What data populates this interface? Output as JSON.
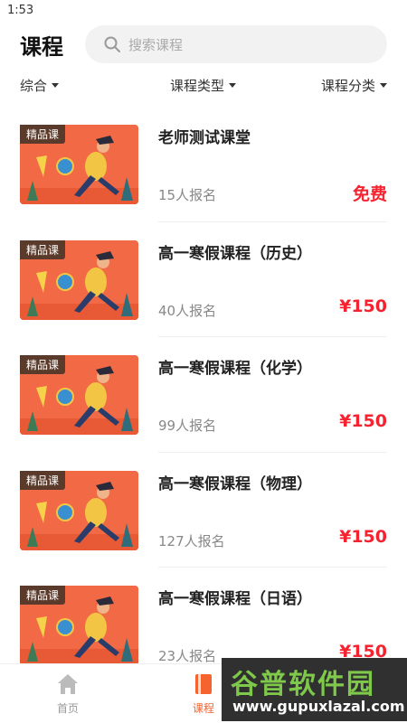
{
  "status_bar": {
    "time": "1:53"
  },
  "header": {
    "title": "课程",
    "search_placeholder": "搜索课程"
  },
  "filters": {
    "all": "综合",
    "type": "课程类型",
    "category": "课程分类"
  },
  "courses": [
    {
      "badge": "精品课",
      "title": "老师测试课堂",
      "enrolled": "15人报名",
      "price": "免费"
    },
    {
      "badge": "精品课",
      "title": "高一寒假课程（历史）",
      "enrolled": "40人报名",
      "price": "¥150"
    },
    {
      "badge": "精品课",
      "title": "高一寒假课程（化学）",
      "enrolled": "99人报名",
      "price": "¥150"
    },
    {
      "badge": "精品课",
      "title": "高一寒假课程（物理）",
      "enrolled": "127人报名",
      "price": "¥150"
    },
    {
      "badge": "精品课",
      "title": "高一寒假课程（日语）",
      "enrolled": "23人报名",
      "price": "¥150"
    }
  ],
  "tabs": {
    "home": "首页",
    "course": "课程"
  },
  "watermark": {
    "main": "谷普软件园",
    "url": "www.gupuxlazal.com"
  },
  "colors": {
    "accent": "#f5632f",
    "price": "#f5232f",
    "badge_bg": "#5a3a2a",
    "watermark_green": "#7ec84a"
  },
  "icons": {
    "search": "search-icon",
    "caret": "caret-down-icon",
    "home": "home-icon",
    "course": "book-icon"
  }
}
